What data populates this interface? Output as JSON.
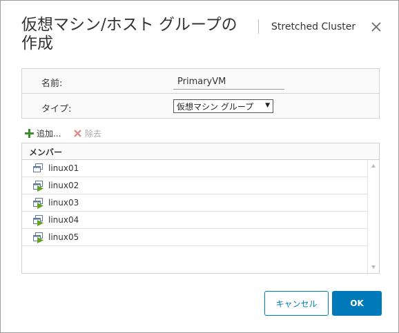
{
  "dialog": {
    "title": "仮想マシン/ホスト グループの作成",
    "context": "Stretched Cluster"
  },
  "form": {
    "name_label": "名前:",
    "name_value": "PrimaryVM",
    "type_label": "タイプ:",
    "type_value": "仮想マシン グループ"
  },
  "toolbar": {
    "add_label": "追加...",
    "remove_label": "除去"
  },
  "members": {
    "header": "メンバー",
    "rows": [
      {
        "name": "linux01",
        "icon": "vm-powered-off-icon"
      },
      {
        "name": "linux02",
        "icon": "vm-powered-on-icon"
      },
      {
        "name": "linux03",
        "icon": "vm-powered-on-icon"
      },
      {
        "name": "linux04",
        "icon": "vm-powered-on-icon"
      },
      {
        "name": "linux05",
        "icon": "vm-powered-on-icon"
      }
    ]
  },
  "buttons": {
    "cancel": "キャンセル",
    "ok": "OK"
  },
  "colors": {
    "accent": "#0079b8",
    "add_icon": "#3c8d2f",
    "remove_icon": "#e08c8c",
    "vm_play": "#62a420"
  }
}
